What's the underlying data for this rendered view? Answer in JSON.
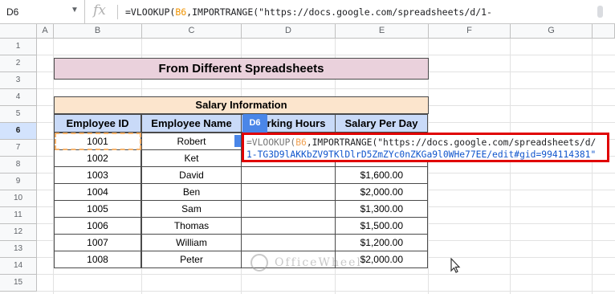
{
  "formula_bar": {
    "cell_ref": "D6",
    "fx_symbol": "fx",
    "text_prefix": "=VLOOKUP(",
    "text_arg": "B6",
    "text_rest": ",IMPORTRANGE(\"https://docs.google.com/spreadsheets/d/1-"
  },
  "columns": [
    "A",
    "B",
    "C",
    "D",
    "E",
    "F",
    "G"
  ],
  "rows": [
    "1",
    "2",
    "3",
    "4",
    "5",
    "6",
    "7",
    "8",
    "9",
    "10",
    "11",
    "12",
    "13",
    "14",
    "15"
  ],
  "selected_row": "6",
  "title": "From Different Spreadsheets",
  "table": {
    "caption": "Salary Information",
    "headers": [
      "Employee ID",
      "Employee Name",
      "Working Hours",
      "Salary Per Day"
    ],
    "rows": [
      {
        "id": "1001",
        "name": "Robert",
        "hours": "",
        "salary": ""
      },
      {
        "id": "1002",
        "name": "Ket",
        "hours": "",
        "salary": ""
      },
      {
        "id": "1003",
        "name": "David",
        "hours": "",
        "salary": "$1,600.00"
      },
      {
        "id": "1004",
        "name": "Ben",
        "hours": "",
        "salary": "$2,000.00"
      },
      {
        "id": "1005",
        "name": "Sam",
        "hours": "",
        "salary": "$1,300.00"
      },
      {
        "id": "1006",
        "name": "Thomas",
        "hours": "",
        "salary": "$1,500.00"
      },
      {
        "id": "1007",
        "name": "William",
        "hours": "",
        "salary": "$1,200.00"
      },
      {
        "id": "1008",
        "name": "Peter",
        "hours": "",
        "salary": "$2,000.00"
      }
    ]
  },
  "editor": {
    "tag": "D6",
    "line1_prefix": "=VLOOKUP(",
    "line1_arg": "B6",
    "line1_rest": ",IMPORTRANGE(\"https://docs.google.com/spreadsheets/d/",
    "line2": "1-TG3D9lAKKbZV9TKlDlrD5ZmZYc0nZKGa9l0WHe77EE/edit#gid=994114381\""
  },
  "watermark": "OfficeWheel",
  "colors": {
    "title_bg": "#ead1dc",
    "caption_bg": "#fce5cd",
    "header_bg": "#c9daf8",
    "editor_border": "#e00000",
    "tag_bg": "#4a86e8"
  }
}
